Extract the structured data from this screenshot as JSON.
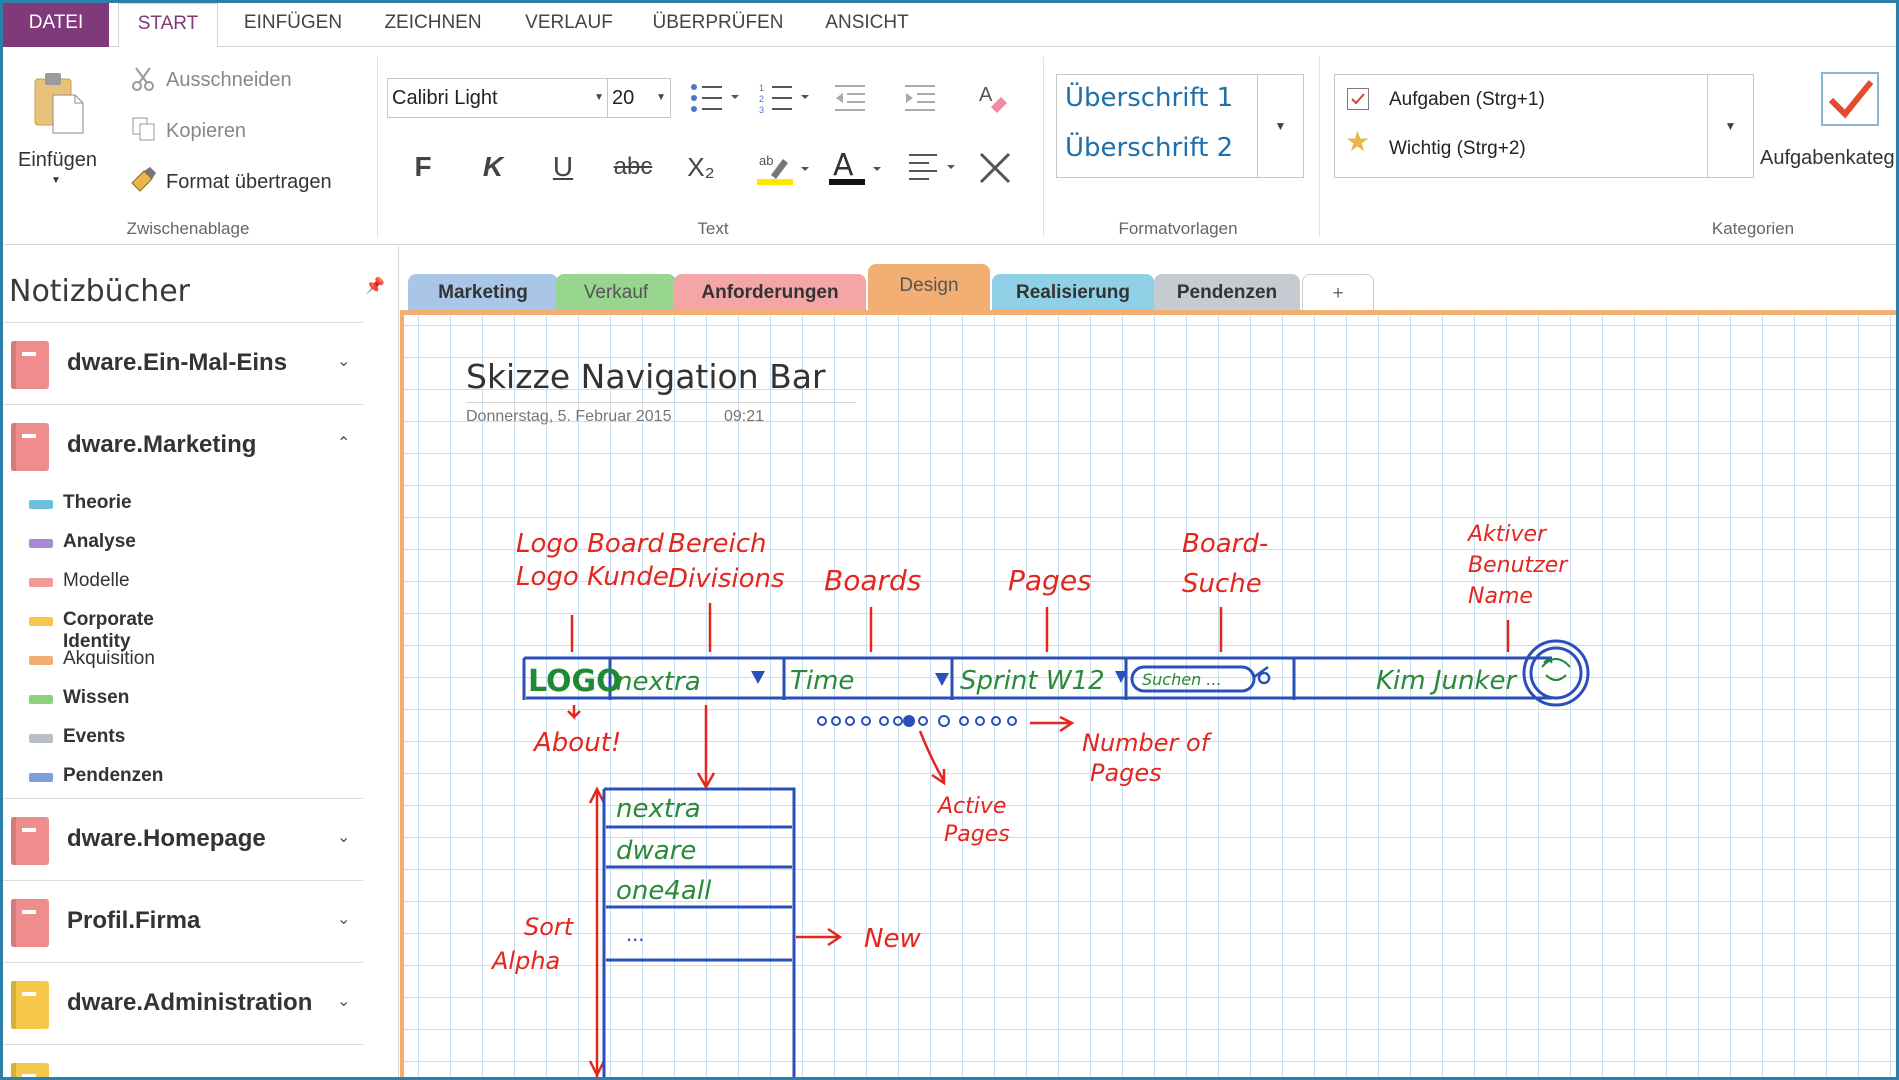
{
  "ribbon_tabs": [
    "DATEI",
    "START",
    "EINFÜGEN",
    "ZEICHNEN",
    "VERLAUF",
    "ÜBERPRÜFEN",
    "ANSICHT"
  ],
  "clipboard": {
    "paste": "Einfügen",
    "cut": "Ausschneiden",
    "copy": "Kopieren",
    "format_painter": "Format übertragen",
    "group": "Zwischenablage"
  },
  "text_group": {
    "font": "Calibri Light",
    "size": "20",
    "bold": "F",
    "italic": "K",
    "underline": "U",
    "strike": "abc",
    "subscript": "X₂",
    "font_color_letter": "A",
    "group": "Text"
  },
  "styles": {
    "items": [
      "Überschrift 1",
      "Überschrift 2"
    ],
    "group": "Formatvorlagen"
  },
  "tags": {
    "items": [
      "Aufgaben (Strg+1)",
      "Wichtig (Strg+2)"
    ],
    "side_label": "Aufgabenkateg",
    "group": "Kategorien"
  },
  "sidebar": {
    "title": "Notizbücher",
    "notebooks": [
      {
        "label": "dware.Ein-Mal-Eins",
        "color": "#ef8c8c",
        "expanded": false
      },
      {
        "label": "dware.Marketing",
        "color": "#ef8c8c",
        "expanded": true
      },
      {
        "label": "dware.Homepage",
        "color": "#ef8c8c",
        "expanded": false
      },
      {
        "label": "Profil.Firma",
        "color": "#ef8c8c",
        "expanded": false
      },
      {
        "label": "dware.Administration",
        "color": "#f5c84b",
        "expanded": false
      }
    ],
    "sections": [
      {
        "label": "Theorie",
        "color": "#6cc0dc",
        "bold": true
      },
      {
        "label": "Analyse",
        "color": "#a68ad6",
        "bold": true
      },
      {
        "label": "Modelle",
        "color": "#f09a9a",
        "bold": false
      },
      {
        "label": "Corporate Identity",
        "color": "#f5c84b",
        "bold": true
      },
      {
        "label": "Akquisition",
        "color": "#f2ae73",
        "bold": false
      },
      {
        "label": "Wissen",
        "color": "#8dd27a",
        "bold": true
      },
      {
        "label": "Events",
        "color": "#b9bec4",
        "bold": true
      },
      {
        "label": "Pendenzen",
        "color": "#7f9ee0",
        "bold": true
      }
    ]
  },
  "section_tabs": [
    {
      "label": "Marketing",
      "color": "#a9c6e8",
      "active": false
    },
    {
      "label": "Verkauf",
      "color": "#98d58f",
      "active": false
    },
    {
      "label": "Anforderungen",
      "color": "#f4a6a6",
      "active": false
    },
    {
      "label": "Design",
      "color": "#f2ae73",
      "active": true
    },
    {
      "label": "Realisierung",
      "color": "#8fd0e6",
      "active": false
    },
    {
      "label": "Pendenzen",
      "color": "#c6cbd1",
      "active": false
    },
    {
      "label": "+",
      "color": "#ffffff",
      "active": false
    }
  ],
  "page": {
    "title": "Skizze Navigation Bar",
    "date": "Donnerstag, 5. Februar 2015",
    "time": "09:21"
  },
  "sketch": {
    "top_labels": [
      "Logo Board",
      "Logo Kunde",
      "Bereich",
      "Divisions",
      "Boards",
      "Pages",
      "Board-",
      "Suche",
      "Aktiver",
      "Benutzer",
      "Name"
    ],
    "bar_items": [
      "LOGO",
      "nextra",
      "Time",
      "Sprint W12",
      "Suchen ...",
      "Kim Junker"
    ],
    "below_labels": [
      "About!",
      "Active",
      "Pages",
      "Number of",
      "Pages",
      "Sort",
      "Alpha",
      "New"
    ],
    "list_items": [
      "nextra",
      "dware",
      "one4all",
      "..."
    ]
  }
}
